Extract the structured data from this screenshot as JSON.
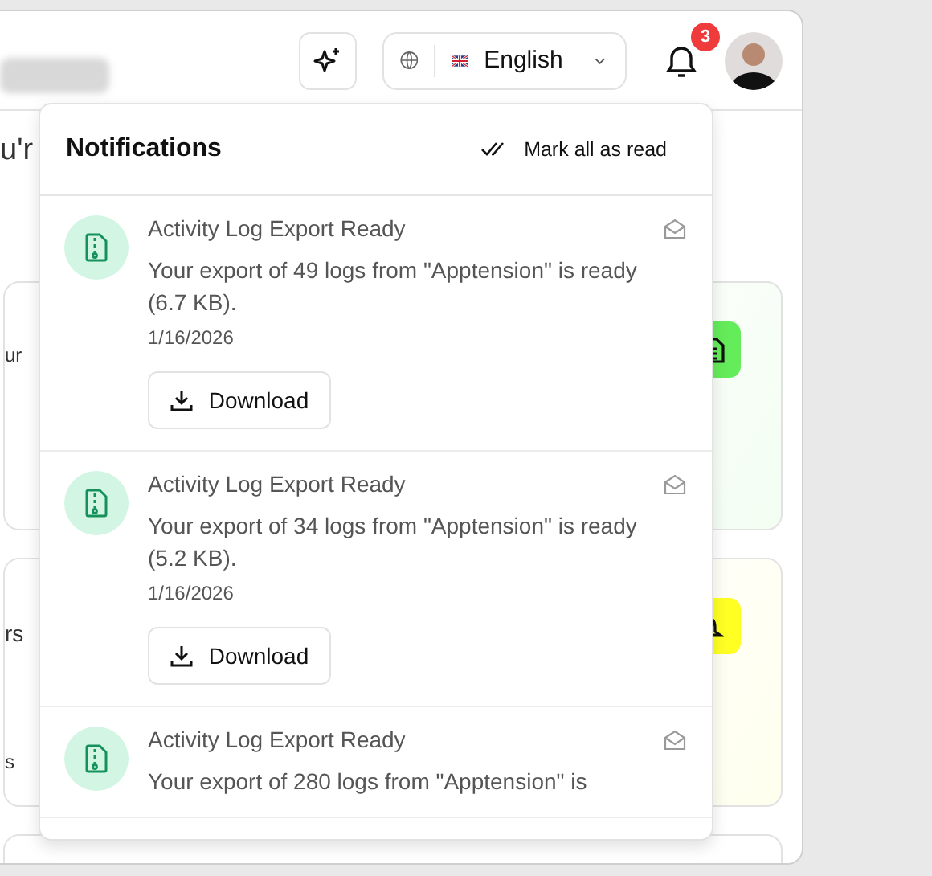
{
  "header": {
    "notification_count": "3",
    "language": "English"
  },
  "intro": "u'r",
  "cards": [
    {
      "kind": "document",
      "color": "#65ec5a",
      "texts": [
        "ur"
      ]
    },
    {
      "kind": "bell",
      "color": "#ffff24",
      "texts": [
        "rs",
        "s"
      ]
    },
    {
      "kind": "empty"
    }
  ],
  "notifications": {
    "title": "Notifications",
    "mark_all": "Mark all as read",
    "items": [
      {
        "title": "Activity Log Export Ready",
        "body": "Your export of 49 logs from \"Apptension\" is ready (6.7 KB).",
        "date": "1/16/2026",
        "action": "Download"
      },
      {
        "title": "Activity Log Export Ready",
        "body": "Your export of 34 logs from \"Apptension\" is ready (5.2 KB).",
        "date": "1/16/2026",
        "action": "Download"
      },
      {
        "title": "Activity Log Export Ready",
        "body": "Your export of 280 logs from \"Apptension\" is"
      }
    ]
  }
}
